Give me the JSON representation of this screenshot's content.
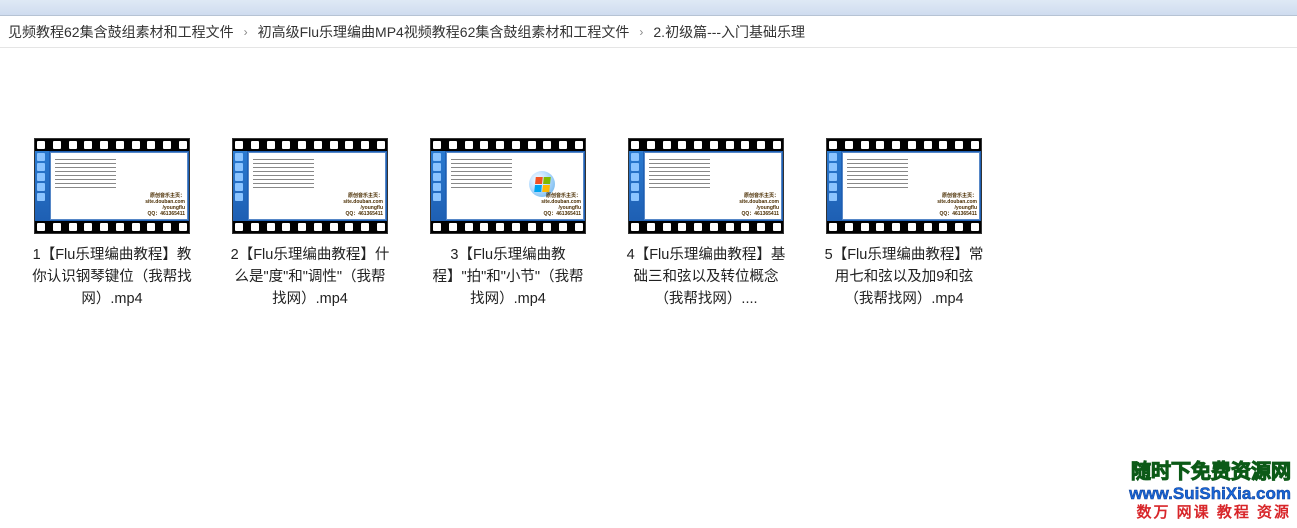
{
  "breadcrumb": {
    "items": [
      "见频教程62集含鼓组素材和工程文件",
      "初高级Flu乐理编曲MP4视频教程62集含鼓组素材和工程文件",
      "2.初级篇---入门基础乐理"
    ]
  },
  "thumb": {
    "watermark": {
      "line1": "原创音乐主页：",
      "line2": "site.douban.com",
      "line3": "/youngflu",
      "line4": "QQ：461365411"
    }
  },
  "files": [
    {
      "name": "1【Flu乐理编曲教程】教你认识钢琴键位（我帮找网）.mp4",
      "has_logo": false
    },
    {
      "name": "2【Flu乐理编曲教程】什么是\"度\"和\"调性\"（我帮找网）.mp4",
      "has_logo": false
    },
    {
      "name": "3【Flu乐理编曲教程】\"拍\"和\"小节\"（我帮找网）.mp4",
      "has_logo": true
    },
    {
      "name": "4【Flu乐理编曲教程】基础三和弦以及转位概念（我帮找网）....",
      "has_logo": false
    },
    {
      "name": "5【Flu乐理编曲教程】常用七和弦以及加9和弦（我帮找网）.mp4",
      "has_logo": false
    }
  ],
  "watermark": {
    "line1": "随时下免费资源网",
    "line2": "www.SuiShiXia.com",
    "line3": "数万 网课 教程 资源"
  }
}
